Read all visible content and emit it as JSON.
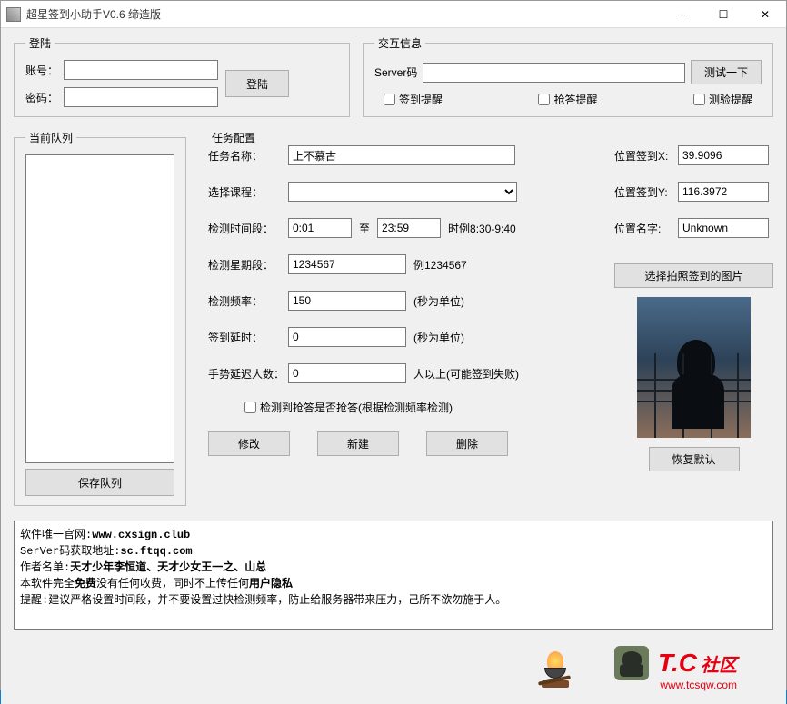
{
  "window": {
    "title": "超星签到小助手V0.6 缔造版"
  },
  "login": {
    "legend": "登陆",
    "account_label": "账号：",
    "password_label": "密码：",
    "button": "登陆"
  },
  "info": {
    "legend": "交互信息",
    "server_label": "Server码",
    "test_button": "测试一下",
    "cb_sign": "签到提醒",
    "cb_grab": "抢答提醒",
    "cb_test": "测验提醒"
  },
  "queue": {
    "legend": "当前队列",
    "save_button": "保存队列"
  },
  "task": {
    "legend": "任务配置",
    "name_label": "任务名称：",
    "name_value": "上不慕古",
    "course_label": "选择课程：",
    "timerange_label": "检测时间段：",
    "time_from": "0:01",
    "time_to_label": "至",
    "time_to": "23:59",
    "time_example": "时例8:30-9:40",
    "weekday_label": "检测星期段：",
    "weekday_value": "1234567",
    "weekday_example": "例1234567",
    "freq_label": "检测频率：",
    "freq_value": "150",
    "freq_unit": "(秒为单位)",
    "delay_label": "签到延时：",
    "delay_value": "0",
    "delay_unit": "(秒为单位)",
    "gesture_label": "手势延迟人数：",
    "gesture_value": "0",
    "gesture_unit": "人以上(可能签到失败)",
    "cb_auto": "检测到抢答是否抢答(根据检测频率检测)",
    "btn_modify": "修改",
    "btn_new": "新建",
    "btn_delete": "删除"
  },
  "location": {
    "x_label": "位置签到X:",
    "x_value": "39.9096",
    "y_label": "位置签到Y:",
    "y_value": "116.3972",
    "name_label": "位置名字:",
    "name_value": "Unknown",
    "pick_button": "选择拍照签到的图片",
    "restore_button": "恢复默认"
  },
  "log": {
    "l1a": "软件唯一官网:",
    "l1b": "www.cxsign.club",
    "l2a": "SerVer码获取地址:",
    "l2b": "sc.ftqq.com",
    "l3a": "作者名单:",
    "l3b": "天才少年李恒道、天才少女王一之、山总",
    "l4a": "本软件完全",
    "l4b": "免费",
    "l4c": "没有任何收费，同时不上传任何",
    "l4d": "用户隐私",
    "l5": "提醒:建议严格设置时间段，并不要设置过快检测频率，防止给服务器带来压力，己所不欲勿施于人。"
  },
  "footer": {
    "brand": "T.C",
    "brand_suffix": "社区",
    "url": "www.tcsqw.com"
  }
}
